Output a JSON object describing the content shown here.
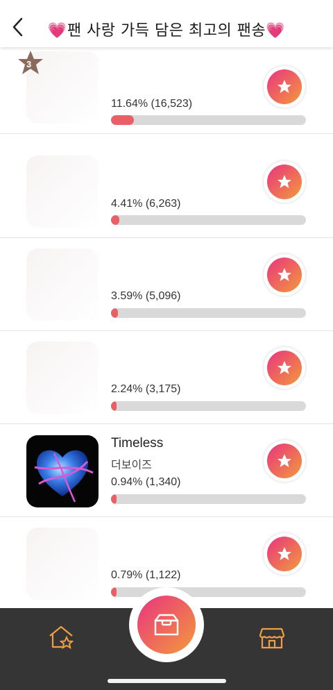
{
  "header": {
    "title": "팬 사랑 가득 담은 최고의 팬송",
    "heart_left": "💗",
    "heart_right": "💗",
    "back_icon": "chevron-left-icon"
  },
  "rows": [
    {
      "rank_badge": "3",
      "song": "",
      "artist": "",
      "percent_text": "11.64% (16,523)",
      "fraction": 0.1164
    },
    {
      "song": "",
      "artist": "",
      "percent_text": "4.41% (6,263)",
      "fraction": 0.0441
    },
    {
      "song": "",
      "artist": "",
      "percent_text": "3.59% (5,096)",
      "fraction": 0.0359
    },
    {
      "song": "",
      "artist": "",
      "percent_text": "2.24% (3,175)",
      "fraction": 0.0224
    },
    {
      "song": "Timeless",
      "artist": "더보이즈",
      "percent_text": "0.94% (1,340)",
      "fraction": 0.0094
    },
    {
      "song": "",
      "artist": "",
      "percent_text": "0.79% (1,122)",
      "fraction": 0.0079
    }
  ],
  "colors": {
    "accent_start": "#e8347e",
    "accent_end": "#f39a3c",
    "bar_fill": "#e86066",
    "bar_track": "#d9d9d9",
    "tabbar": "#353535",
    "tab_icon": "#f0a040"
  },
  "tabbar": {
    "left_icon": "home-star-icon",
    "center_icon": "ballot-box-icon",
    "right_icon": "store-icon"
  }
}
